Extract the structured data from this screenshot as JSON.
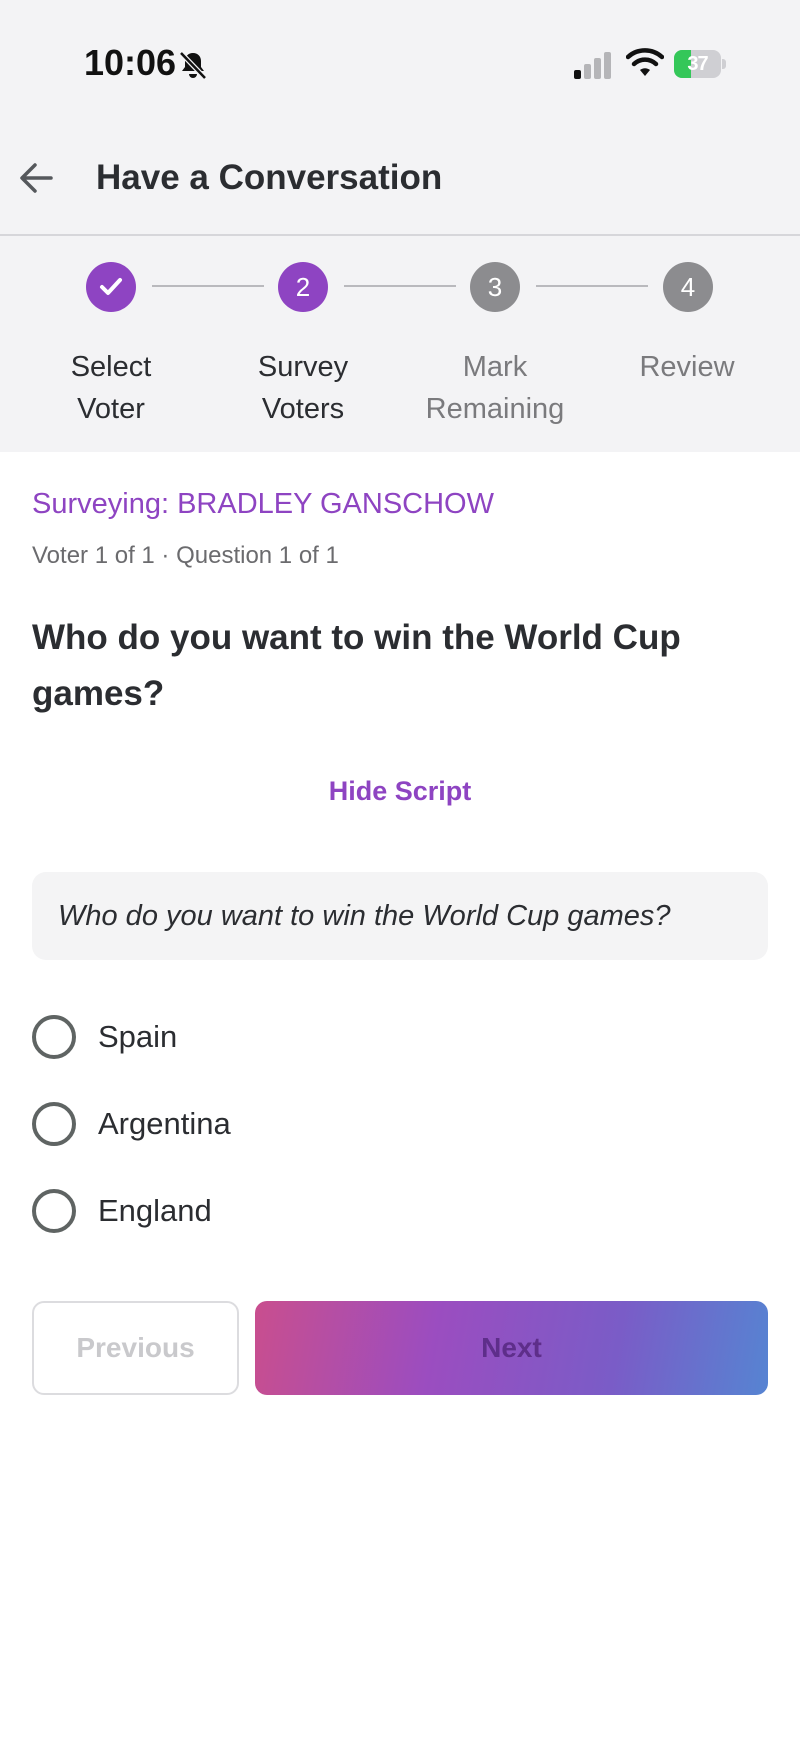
{
  "status_bar": {
    "time": "10:06",
    "battery": "37",
    "battery_percent": 37
  },
  "header": {
    "title": "Have a Conversation"
  },
  "stepper": {
    "steps": [
      {
        "number": "1",
        "label_line1": "Select",
        "label_line2": "Voter",
        "state": "done"
      },
      {
        "number": "2",
        "label_line1": "Survey",
        "label_line2": "Voters",
        "state": "active"
      },
      {
        "number": "3",
        "label_line1": "Mark",
        "label_line2": "Remaining",
        "state": "pending"
      },
      {
        "number": "4",
        "label_line1": "Review",
        "label_line2": "",
        "state": "pending"
      }
    ]
  },
  "survey": {
    "surveying_label": "Surveying: BRADLEY GANSCHOW",
    "progress": "Voter 1 of 1 · Question 1 of 1",
    "question": "Who do you want to win the World Cup games?",
    "toggle_script_label": "Hide Script",
    "script_text": "Who do you want to win the World Cup games?",
    "options": [
      {
        "label": "Spain",
        "selected": false
      },
      {
        "label": "Argentina",
        "selected": false
      },
      {
        "label": "England",
        "selected": false
      }
    ]
  },
  "actions": {
    "previous_label": "Previous",
    "next_label": "Next"
  },
  "colors": {
    "accent": "#8e44c2",
    "pending_step": "#8c8c8f",
    "gradient_start": "#c94e8e",
    "gradient_end": "#5684d2"
  }
}
